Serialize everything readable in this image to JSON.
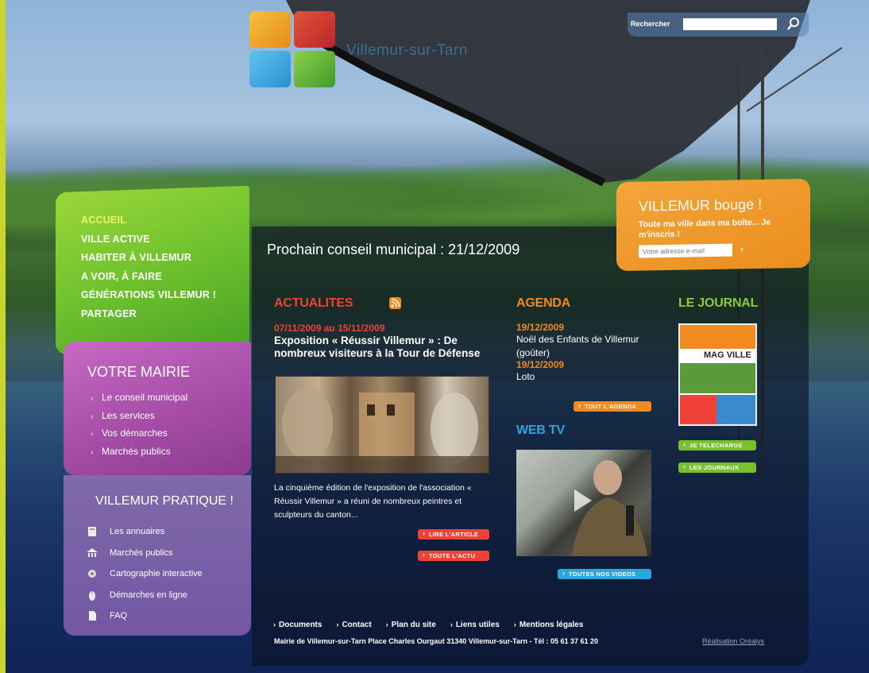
{
  "header": {
    "site_name": "Villemur-sur-Tarn",
    "search_label": "Rechercher",
    "search_placeholder": ""
  },
  "main_nav": {
    "items": [
      {
        "label": "ACCUEIL",
        "active": true
      },
      {
        "label": "VILLE ACTIVE"
      },
      {
        "label": "HABITER À VILLEMUR"
      },
      {
        "label": "A VOIR, À FAIRE"
      },
      {
        "label": "GÉNÉRATIONS VILLEMUR !"
      },
      {
        "label": "PARTAGER"
      }
    ]
  },
  "mairie": {
    "title": "VOTRE MAIRIE",
    "items": [
      "Le conseil municipal",
      "Les services",
      "Vos démarches",
      "Marchés publics"
    ]
  },
  "pratique": {
    "title": "VILLEMUR PRATIQUE !",
    "items": [
      {
        "label": "Les annuaires",
        "icon": "directory-icon"
      },
      {
        "label": "Marchés publics",
        "icon": "building-icon"
      },
      {
        "label": "Cartographie interactive",
        "icon": "map-icon"
      },
      {
        "label": "Démarches en ligne",
        "icon": "mouse-icon"
      },
      {
        "label": "FAQ",
        "icon": "document-icon"
      }
    ]
  },
  "conseil": "Prochain conseil municipal : 21/12/2009",
  "actualites": {
    "title": "ACTUALITES",
    "date": "07/11/2009 au 15/11/2009",
    "headline": "Exposition « Réussir Villemur » : De nombreux visiteurs à la Tour de Défense",
    "description": "La cinquième édition de l'exposition de l'association « Réussir Villemur » a réuni de nombreux peintres et sculpteurs du canton...",
    "btn_read": "LIRE L'ARTICLE",
    "btn_all": "TOUTE L'ACTU"
  },
  "agenda": {
    "title": "AGENDA",
    "events": [
      {
        "date": "19/12/2009",
        "label": "Noël des Enfants de Villemur (goûter)"
      },
      {
        "date": "19/12/2009",
        "label": "Loto"
      }
    ],
    "btn_all": "TOUT L'AGENDA"
  },
  "webtv": {
    "title": "WEB TV",
    "btn_all": "TOUTES NOS VIDEOS"
  },
  "journal": {
    "title": "LE JOURNAL",
    "cover_title": "MAG VILLE",
    "btn_download": "JE TELECHARGE",
    "btn_all": "LES JOURNAUX"
  },
  "newsletter": {
    "title": "VILLEMUR bouge !",
    "text": "Toute ma ville dans ma boîte... Je m'inscris !",
    "placeholder": "Votre adresse e-mail"
  },
  "footer": {
    "links": [
      "Documents",
      "Contact",
      "Plan du site",
      "Liens utiles",
      "Mentions légales"
    ],
    "address": "Mairie de Villemur-sur-Tarn Place Charles Ourgaut 31340 Villemur-sur-Tarn - Tél : 05 61 37 61 20",
    "credit": "Réalisation Oréalys"
  },
  "colors": {
    "accent_green": "#79bf2e",
    "accent_purple": "#a54da7",
    "accent_orange": "#f08a21",
    "accent_red": "#ef4135",
    "accent_blue": "#2aa7e0"
  }
}
